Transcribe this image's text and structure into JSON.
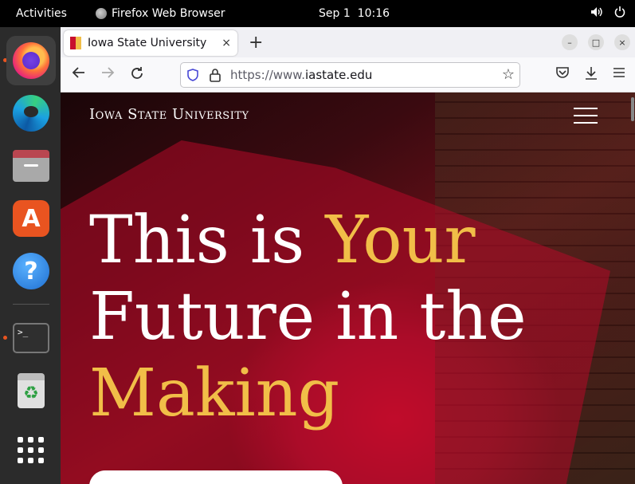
{
  "topbar": {
    "activities": "Activities",
    "app_name": "Firefox Web Browser",
    "date": "Sep 1",
    "time": "10:16",
    "volume_icon": "speaker-icon",
    "power_icon": "power-icon"
  },
  "dock": {
    "items": [
      {
        "name": "firefox",
        "running": true
      },
      {
        "name": "microsoft-edge",
        "running": false
      },
      {
        "name": "files",
        "running": false
      },
      {
        "name": "ubuntu-software",
        "running": false
      },
      {
        "name": "help",
        "running": false
      },
      {
        "name": "terminal",
        "running": true
      },
      {
        "name": "trash",
        "running": false
      },
      {
        "name": "show-applications",
        "running": false
      }
    ],
    "store_glyph": "A",
    "help_glyph": "?",
    "terminal_glyph": ">_",
    "trash_glyph": "♻"
  },
  "browser": {
    "tab_title": "Iowa State University",
    "tab_close": "×",
    "new_tab": "+",
    "url_scheme": "https://www.",
    "url_domain": "iastate.edu",
    "window_controls": {
      "minimize": "–",
      "maximize": "□",
      "close": "×"
    }
  },
  "site": {
    "logo_text": "Iowa State University",
    "hero_line1_white": "This is ",
    "hero_line1_gold": "Your",
    "hero_line2": "Future in the",
    "hero_line3": "Making"
  },
  "colors": {
    "isu_cardinal": "#c8102e",
    "isu_gold": "#f1be48",
    "ubuntu_orange": "#e95420"
  }
}
